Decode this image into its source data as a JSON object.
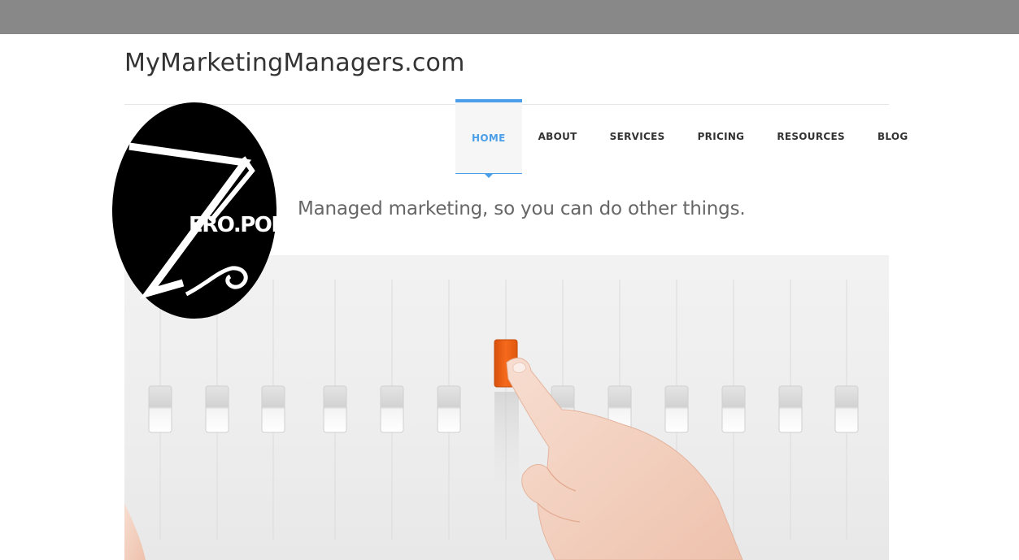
{
  "site": {
    "title": "MyMarketingManagers.com",
    "tagline": "Managed marketing, so you can do other things."
  },
  "nav": {
    "items": [
      {
        "label": "HOME",
        "active": true
      },
      {
        "label": "ABOUT",
        "active": false
      },
      {
        "label": "SERVICES",
        "active": false
      },
      {
        "label": "PRICING",
        "active": false
      },
      {
        "label": "RESOURCES",
        "active": false
      },
      {
        "label": "BLOG",
        "active": false
      }
    ]
  },
  "logo": {
    "text": "ERO.POINT",
    "icon": "zero-point-logo-icon"
  },
  "hero": {
    "image": "mixing-console-sliders-with-finger-image",
    "accent_color": "#f06414"
  },
  "colors": {
    "topbar": "#888888",
    "nav_active": "#4a9fe8",
    "title_text": "#333333",
    "tagline_text": "#666666"
  }
}
